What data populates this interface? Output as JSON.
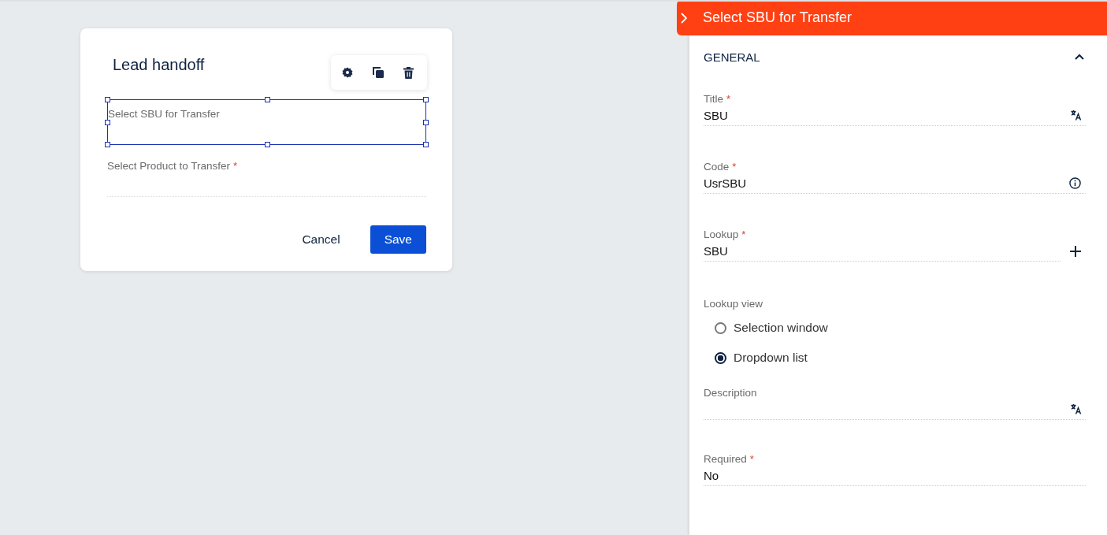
{
  "dialog": {
    "title": "Lead handoff",
    "fields": [
      {
        "label": "Select SBU for Transfer",
        "selected": true
      },
      {
        "label": "Select Product to Transfer",
        "required_mark": "*",
        "selected": false
      }
    ],
    "buttons": [
      {
        "label": "Cancel",
        "kind": "text"
      },
      {
        "label": "Save",
        "kind": "primary"
      }
    ]
  },
  "panel": {
    "title": "Select SBU for Transfer",
    "section": {
      "title": "GENERAL",
      "expanded": true
    },
    "fields": [
      {
        "kind": "translatable",
        "label": "Title",
        "required_mark": "*",
        "value": "SBU"
      },
      {
        "kind": "info",
        "label": "Code",
        "required_mark": "*",
        "value": "UsrSBU"
      },
      {
        "kind": "lookup",
        "label": "Lookup",
        "required_mark": "*",
        "value": "SBU"
      },
      {
        "kind": "radio",
        "label": "Lookup view",
        "options": [
          {
            "label": "Selection window",
            "selected": false
          },
          {
            "label": "Dropdown list",
            "selected": true
          }
        ]
      },
      {
        "kind": "translatable",
        "label": "Description"
      },
      {
        "kind": "plain",
        "label": "Required",
        "required_mark": "*",
        "value": "No"
      }
    ]
  }
}
